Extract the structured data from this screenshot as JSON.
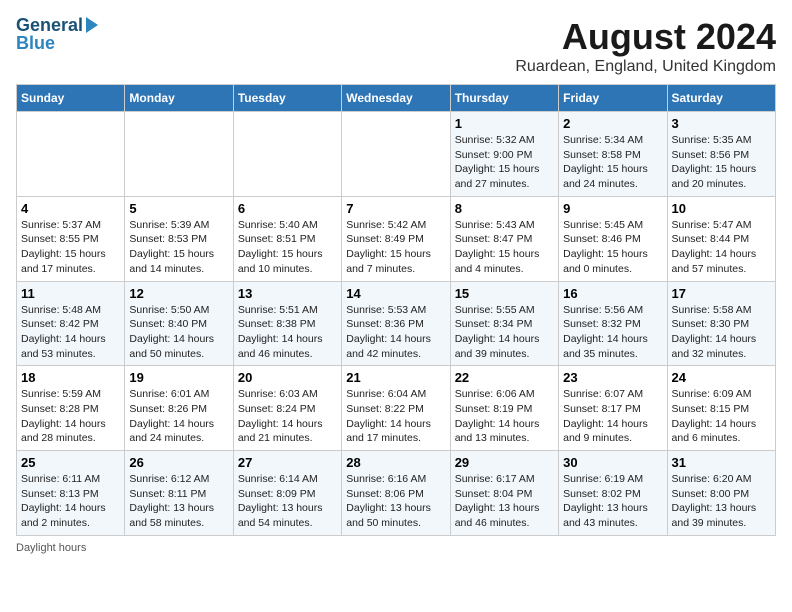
{
  "logo": {
    "line1": "General",
    "line2": "Blue"
  },
  "title": "August 2024",
  "subtitle": "Ruardean, England, United Kingdom",
  "weekdays": [
    "Sunday",
    "Monday",
    "Tuesday",
    "Wednesday",
    "Thursday",
    "Friday",
    "Saturday"
  ],
  "weeks": [
    [
      {
        "day": "",
        "info": ""
      },
      {
        "day": "",
        "info": ""
      },
      {
        "day": "",
        "info": ""
      },
      {
        "day": "",
        "info": ""
      },
      {
        "day": "1",
        "info": "Sunrise: 5:32 AM\nSunset: 9:00 PM\nDaylight: 15 hours and 27 minutes."
      },
      {
        "day": "2",
        "info": "Sunrise: 5:34 AM\nSunset: 8:58 PM\nDaylight: 15 hours and 24 minutes."
      },
      {
        "day": "3",
        "info": "Sunrise: 5:35 AM\nSunset: 8:56 PM\nDaylight: 15 hours and 20 minutes."
      }
    ],
    [
      {
        "day": "4",
        "info": "Sunrise: 5:37 AM\nSunset: 8:55 PM\nDaylight: 15 hours and 17 minutes."
      },
      {
        "day": "5",
        "info": "Sunrise: 5:39 AM\nSunset: 8:53 PM\nDaylight: 15 hours and 14 minutes."
      },
      {
        "day": "6",
        "info": "Sunrise: 5:40 AM\nSunset: 8:51 PM\nDaylight: 15 hours and 10 minutes."
      },
      {
        "day": "7",
        "info": "Sunrise: 5:42 AM\nSunset: 8:49 PM\nDaylight: 15 hours and 7 minutes."
      },
      {
        "day": "8",
        "info": "Sunrise: 5:43 AM\nSunset: 8:47 PM\nDaylight: 15 hours and 4 minutes."
      },
      {
        "day": "9",
        "info": "Sunrise: 5:45 AM\nSunset: 8:46 PM\nDaylight: 15 hours and 0 minutes."
      },
      {
        "day": "10",
        "info": "Sunrise: 5:47 AM\nSunset: 8:44 PM\nDaylight: 14 hours and 57 minutes."
      }
    ],
    [
      {
        "day": "11",
        "info": "Sunrise: 5:48 AM\nSunset: 8:42 PM\nDaylight: 14 hours and 53 minutes."
      },
      {
        "day": "12",
        "info": "Sunrise: 5:50 AM\nSunset: 8:40 PM\nDaylight: 14 hours and 50 minutes."
      },
      {
        "day": "13",
        "info": "Sunrise: 5:51 AM\nSunset: 8:38 PM\nDaylight: 14 hours and 46 minutes."
      },
      {
        "day": "14",
        "info": "Sunrise: 5:53 AM\nSunset: 8:36 PM\nDaylight: 14 hours and 42 minutes."
      },
      {
        "day": "15",
        "info": "Sunrise: 5:55 AM\nSunset: 8:34 PM\nDaylight: 14 hours and 39 minutes."
      },
      {
        "day": "16",
        "info": "Sunrise: 5:56 AM\nSunset: 8:32 PM\nDaylight: 14 hours and 35 minutes."
      },
      {
        "day": "17",
        "info": "Sunrise: 5:58 AM\nSunset: 8:30 PM\nDaylight: 14 hours and 32 minutes."
      }
    ],
    [
      {
        "day": "18",
        "info": "Sunrise: 5:59 AM\nSunset: 8:28 PM\nDaylight: 14 hours and 28 minutes."
      },
      {
        "day": "19",
        "info": "Sunrise: 6:01 AM\nSunset: 8:26 PM\nDaylight: 14 hours and 24 minutes."
      },
      {
        "day": "20",
        "info": "Sunrise: 6:03 AM\nSunset: 8:24 PM\nDaylight: 14 hours and 21 minutes."
      },
      {
        "day": "21",
        "info": "Sunrise: 6:04 AM\nSunset: 8:22 PM\nDaylight: 14 hours and 17 minutes."
      },
      {
        "day": "22",
        "info": "Sunrise: 6:06 AM\nSunset: 8:19 PM\nDaylight: 14 hours and 13 minutes."
      },
      {
        "day": "23",
        "info": "Sunrise: 6:07 AM\nSunset: 8:17 PM\nDaylight: 14 hours and 9 minutes."
      },
      {
        "day": "24",
        "info": "Sunrise: 6:09 AM\nSunset: 8:15 PM\nDaylight: 14 hours and 6 minutes."
      }
    ],
    [
      {
        "day": "25",
        "info": "Sunrise: 6:11 AM\nSunset: 8:13 PM\nDaylight: 14 hours and 2 minutes."
      },
      {
        "day": "26",
        "info": "Sunrise: 6:12 AM\nSunset: 8:11 PM\nDaylight: 13 hours and 58 minutes."
      },
      {
        "day": "27",
        "info": "Sunrise: 6:14 AM\nSunset: 8:09 PM\nDaylight: 13 hours and 54 minutes."
      },
      {
        "day": "28",
        "info": "Sunrise: 6:16 AM\nSunset: 8:06 PM\nDaylight: 13 hours and 50 minutes."
      },
      {
        "day": "29",
        "info": "Sunrise: 6:17 AM\nSunset: 8:04 PM\nDaylight: 13 hours and 46 minutes."
      },
      {
        "day": "30",
        "info": "Sunrise: 6:19 AM\nSunset: 8:02 PM\nDaylight: 13 hours and 43 minutes."
      },
      {
        "day": "31",
        "info": "Sunrise: 6:20 AM\nSunset: 8:00 PM\nDaylight: 13 hours and 39 minutes."
      }
    ]
  ],
  "footer": "Daylight hours"
}
